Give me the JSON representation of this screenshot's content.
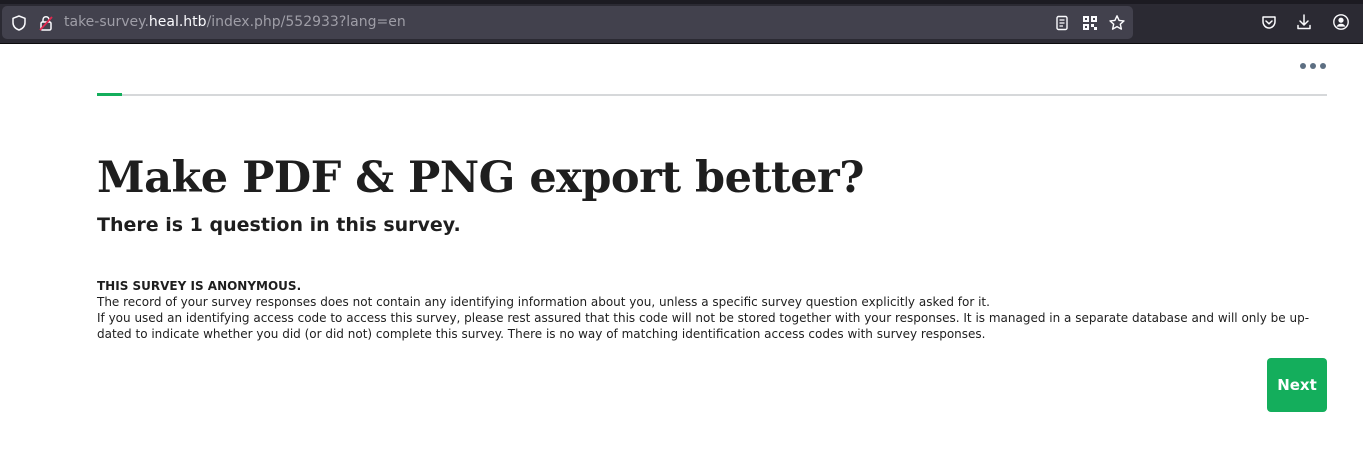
{
  "browser": {
    "url_prefix": "take-survey.",
    "url_host": "heal.htb",
    "url_path": "/index.php/552933?lang=en",
    "icons": {
      "site_info": "shield-icon",
      "permissions": "lock-warning-icon",
      "reader_mode": "reader-view-icon",
      "extension": "qr-code-icon",
      "bookmark": "star-icon",
      "pocket": "pocket-icon",
      "downloads": "download-icon",
      "account": "account-icon"
    }
  },
  "survey": {
    "menu_icon": "more-horizontal-icon",
    "progress_percent": 2,
    "title": "Make PDF & PNG export better?",
    "question_count": "There is 1 question in this survey.",
    "privacy": {
      "heading": "THIS SURVEY IS ANONYMOUS.",
      "line1": "The record of your survey responses does not contain any identifying information about you, unless a specific survey question explicitly asked for it.",
      "line2": "If you used an identifying access code to access this survey, please rest assured that this code will not be stored together with your responses. It is managed in a separate database and will only be up-",
      "line3": "dated to indicate whether you did (or did not) complete this survey. There is no way of matching identification access codes with survey responses."
    },
    "next_label": "Next"
  },
  "colors": {
    "accent": "#14ae5c",
    "chrome_bg": "#2b2a33",
    "urlbar_bg": "#42414d",
    "text": "#1e1e1e"
  }
}
